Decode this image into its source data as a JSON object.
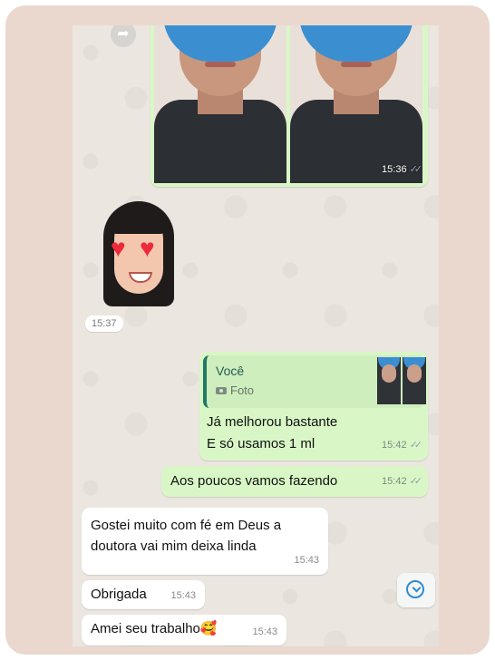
{
  "chat": {
    "photo_message": {
      "time": "15:36"
    },
    "sticker_message": {
      "time": "15:37"
    },
    "reply_message": {
      "quoted_author": "Você",
      "quoted_type": "Foto",
      "line1": "Já melhorou bastante",
      "line2": "E só usamos 1 ml",
      "time": "15:42"
    },
    "out_message": {
      "text": "Aos poucos vamos fazendo",
      "time": "15:42"
    },
    "in_messages": [
      {
        "line1": "Gostei muito com fé em Deus a",
        "line2": "doutora vai mim deixa linda",
        "time": "15:43"
      },
      {
        "text": "Obrigada",
        "time": "15:43"
      },
      {
        "text": "Amei seu trabalho🥰",
        "time": "15:43"
      }
    ]
  },
  "icons": {
    "forward": "forward-icon",
    "camera": "camera-icon",
    "read_ticks": "double-check-icon",
    "scroll_down": "chevron-down-circle-icon",
    "sticker": "heart-eyes-memoji-sticker"
  },
  "colors": {
    "frame": "#ead8cf",
    "chat_bg": "#ebe6df",
    "outgoing": "#d9f7c6",
    "incoming": "#ffffff",
    "accent": "#1f7a66"
  }
}
